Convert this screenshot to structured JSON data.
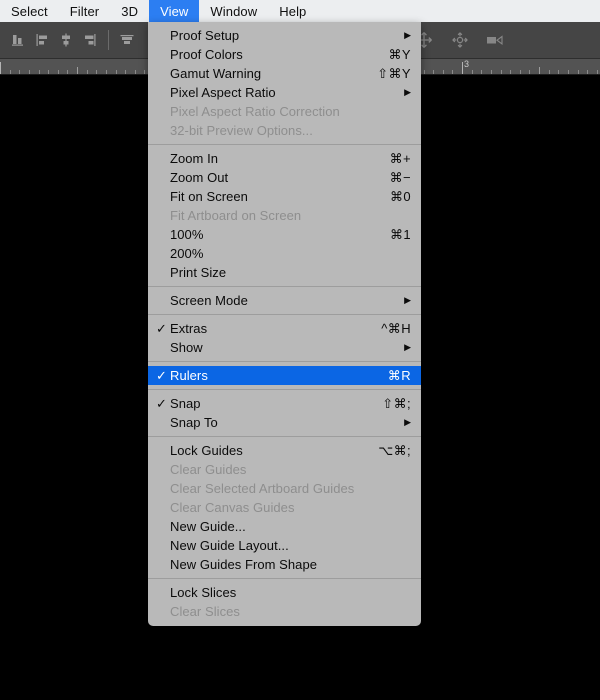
{
  "menubar": {
    "items": [
      {
        "label": "Select",
        "active": false
      },
      {
        "label": "Filter",
        "active": false
      },
      {
        "label": "3D",
        "active": false
      },
      {
        "label": "View",
        "active": true
      },
      {
        "label": "Window",
        "active": false
      },
      {
        "label": "Help",
        "active": false
      }
    ]
  },
  "options_bar": {
    "left_icons": [
      "align-bottom-edges-icon",
      "align-left-edges-icon",
      "align-horizontal-centers-icon",
      "align-right-edges-icon",
      "distribute-top-edges-icon"
    ],
    "right_icons": [
      "move-tool-icon",
      "rotate-3d-icon",
      "video-camera-icon"
    ]
  },
  "ruler": {
    "unit_labels": [
      "3"
    ],
    "label_positions": [
      461
    ]
  },
  "menu": {
    "title": "View",
    "groups": [
      {
        "items": [
          {
            "label": "Proof Setup",
            "shortcut": "",
            "submenu": true,
            "checked": false,
            "disabled": false,
            "selected": false
          },
          {
            "label": "Proof Colors",
            "shortcut": "⌘Y",
            "submenu": false,
            "checked": false,
            "disabled": false,
            "selected": false
          },
          {
            "label": "Gamut Warning",
            "shortcut": "⇧⌘Y",
            "submenu": false,
            "checked": false,
            "disabled": false,
            "selected": false
          },
          {
            "label": "Pixel Aspect Ratio",
            "shortcut": "",
            "submenu": true,
            "checked": false,
            "disabled": false,
            "selected": false
          },
          {
            "label": "Pixel Aspect Ratio Correction",
            "shortcut": "",
            "submenu": false,
            "checked": false,
            "disabled": true,
            "selected": false
          },
          {
            "label": "32-bit Preview Options...",
            "shortcut": "",
            "submenu": false,
            "checked": false,
            "disabled": true,
            "selected": false
          }
        ]
      },
      {
        "items": [
          {
            "label": "Zoom In",
            "shortcut": "⌘+",
            "submenu": false,
            "checked": false,
            "disabled": false,
            "selected": false
          },
          {
            "label": "Zoom Out",
            "shortcut": "⌘−",
            "submenu": false,
            "checked": false,
            "disabled": false,
            "selected": false
          },
          {
            "label": "Fit on Screen",
            "shortcut": "⌘0",
            "submenu": false,
            "checked": false,
            "disabled": false,
            "selected": false
          },
          {
            "label": "Fit Artboard on Screen",
            "shortcut": "",
            "submenu": false,
            "checked": false,
            "disabled": true,
            "selected": false
          },
          {
            "label": "100%",
            "shortcut": "⌘1",
            "submenu": false,
            "checked": false,
            "disabled": false,
            "selected": false
          },
          {
            "label": "200%",
            "shortcut": "",
            "submenu": false,
            "checked": false,
            "disabled": false,
            "selected": false
          },
          {
            "label": "Print Size",
            "shortcut": "",
            "submenu": false,
            "checked": false,
            "disabled": false,
            "selected": false
          }
        ]
      },
      {
        "items": [
          {
            "label": "Screen Mode",
            "shortcut": "",
            "submenu": true,
            "checked": false,
            "disabled": false,
            "selected": false
          }
        ]
      },
      {
        "items": [
          {
            "label": "Extras",
            "shortcut": "^⌘H",
            "submenu": false,
            "checked": true,
            "disabled": false,
            "selected": false
          },
          {
            "label": "Show",
            "shortcut": "",
            "submenu": true,
            "checked": false,
            "disabled": false,
            "selected": false
          }
        ]
      },
      {
        "items": [
          {
            "label": "Rulers",
            "shortcut": "⌘R",
            "submenu": false,
            "checked": true,
            "disabled": false,
            "selected": true
          }
        ]
      },
      {
        "items": [
          {
            "label": "Snap",
            "shortcut": "⇧⌘;",
            "submenu": false,
            "checked": true,
            "disabled": false,
            "selected": false
          },
          {
            "label": "Snap To",
            "shortcut": "",
            "submenu": true,
            "checked": false,
            "disabled": false,
            "selected": false
          }
        ]
      },
      {
        "items": [
          {
            "label": "Lock Guides",
            "shortcut": "⌥⌘;",
            "submenu": false,
            "checked": false,
            "disabled": false,
            "selected": false
          },
          {
            "label": "Clear Guides",
            "shortcut": "",
            "submenu": false,
            "checked": false,
            "disabled": true,
            "selected": false
          },
          {
            "label": "Clear Selected Artboard Guides",
            "shortcut": "",
            "submenu": false,
            "checked": false,
            "disabled": true,
            "selected": false
          },
          {
            "label": "Clear Canvas Guides",
            "shortcut": "",
            "submenu": false,
            "checked": false,
            "disabled": true,
            "selected": false
          },
          {
            "label": "New Guide...",
            "shortcut": "",
            "submenu": false,
            "checked": false,
            "disabled": false,
            "selected": false
          },
          {
            "label": "New Guide Layout...",
            "shortcut": "",
            "submenu": false,
            "checked": false,
            "disabled": false,
            "selected": false
          },
          {
            "label": "New Guides From Shape",
            "shortcut": "",
            "submenu": false,
            "checked": false,
            "disabled": false,
            "selected": false
          }
        ]
      },
      {
        "items": [
          {
            "label": "Lock Slices",
            "shortcut": "",
            "submenu": false,
            "checked": false,
            "disabled": false,
            "selected": false
          },
          {
            "label": "Clear Slices",
            "shortcut": "",
            "submenu": false,
            "checked": false,
            "disabled": true,
            "selected": false
          }
        ]
      }
    ]
  },
  "colors": {
    "menubar_bg": "#eceef0",
    "menubar_highlight": "#2c7ef2",
    "dropdown_bg": "#b9b9b9",
    "dropdown_selected": "#0b66e4",
    "options_bar_bg": "#454545",
    "ruler_bg": "#535353",
    "canvas_bg": "#000000",
    "disabled_text": "#8e8e8e"
  }
}
